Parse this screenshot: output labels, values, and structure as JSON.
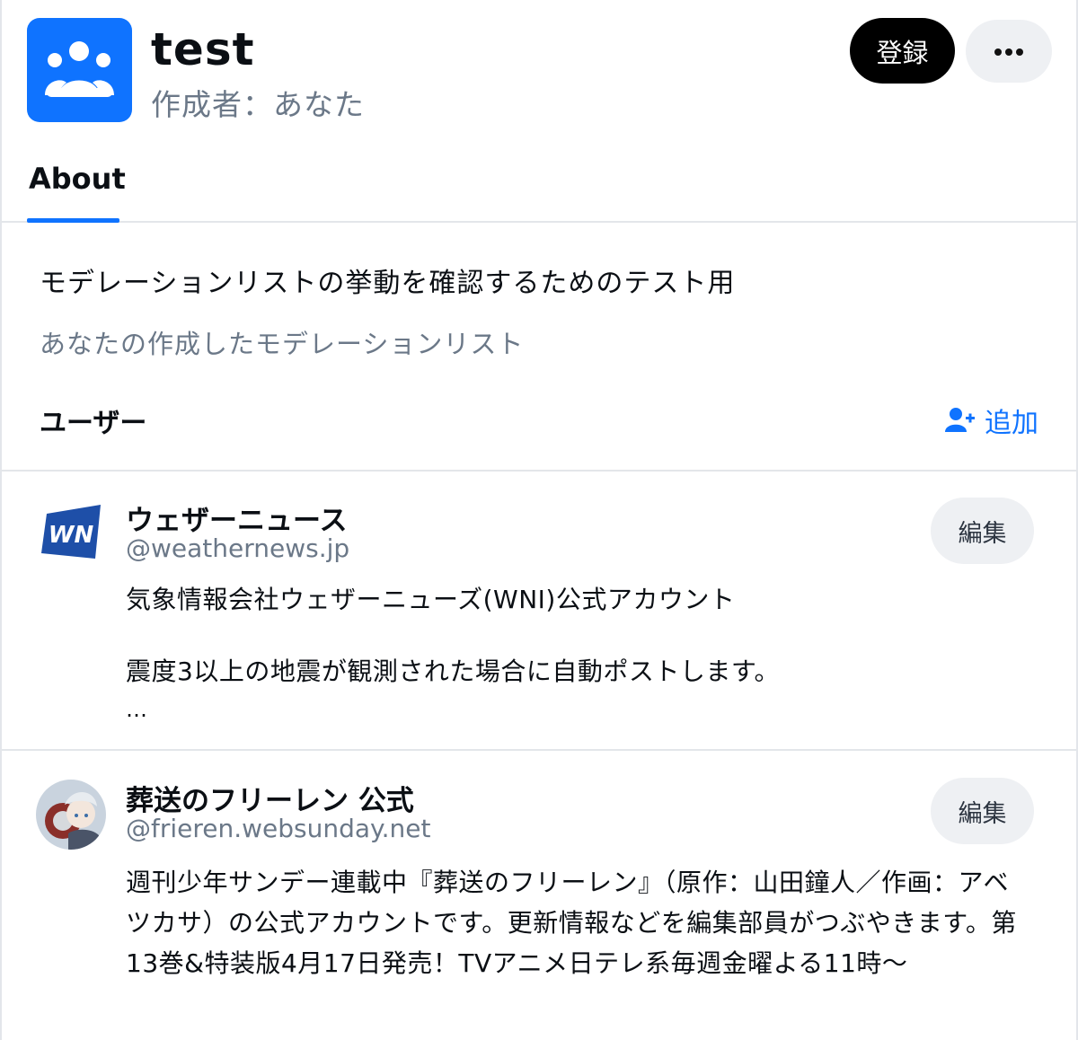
{
  "header": {
    "title": "test",
    "creator": "作成者：あなた",
    "subscribe_label": "登録"
  },
  "tabs": [
    {
      "label": "About",
      "active": true
    }
  ],
  "about": {
    "description": "モデレーションリストの挙動を確認するためのテスト用",
    "purpose": "あなたの作成したモデレーションリスト",
    "users_title": "ユーザー",
    "add_label": "追加"
  },
  "users": [
    {
      "display_name": "ウェザーニュース",
      "handle": "@weathernews.jp",
      "edit_label": "編集",
      "bio": "気象情報会社ウェザーニューズ(WNI)公式アカウント\n\n震度3以上の地震が観測された場合に自動ポストします。",
      "bio_more": "…",
      "avatar_text": "WN"
    },
    {
      "display_name": "葬送のフリーレン 公式",
      "handle": "@frieren.websunday.net",
      "edit_label": "編集",
      "bio": "週刊少年サンデー連載中『葬送のフリーレン』（原作：山田鐘人／作画：アベツカサ）の公式アカウントです。更新情報などを編集部員がつぶやきます。第13巻&特装版4月17日発売！TVアニメ日テレ系毎週金曜よる11時〜"
    }
  ],
  "colors": {
    "accent": "#0f73ff",
    "muted_text": "#6b7888",
    "divider": "#e3e6ea",
    "button_bg": "#eef0f3"
  },
  "icons": {
    "list_avatar": "people-group-icon",
    "more": "ellipsis-icon",
    "add": "person-plus-icon"
  }
}
